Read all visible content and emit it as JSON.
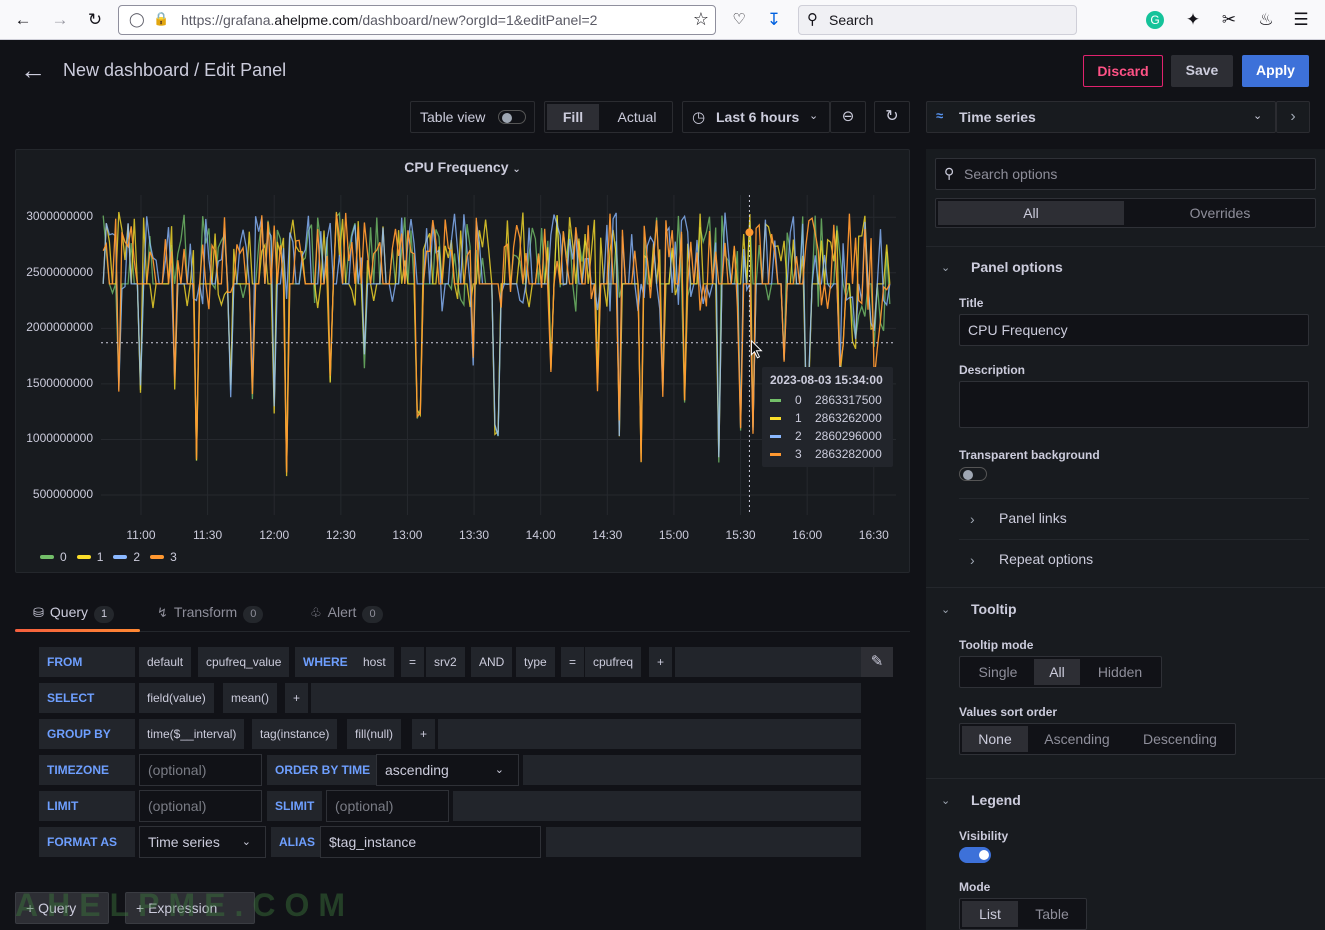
{
  "browser": {
    "url_prefix": "https://grafana.",
    "url_domain": "ahelpme.com",
    "url_suffix": "/dashboard/new?orgId=1&editPanel=2",
    "search_placeholder": "Search"
  },
  "header": {
    "title": "New dashboard / Edit Panel",
    "discard_label": "Discard",
    "save_label": "Save",
    "apply_label": "Apply"
  },
  "toolbar": {
    "table_view_label": "Table view",
    "fill_label": "Fill",
    "actual_label": "Actual",
    "time_range_label": "Last 6 hours"
  },
  "panel": {
    "title": "CPU Frequency",
    "tooltip": {
      "time": "2023-08-03 15:34:00",
      "rows": [
        {
          "name": "0",
          "value": "2863317500",
          "color": "#73bf69"
        },
        {
          "name": "1",
          "value": "2863262000",
          "color": "#fade2a"
        },
        {
          "name": "2",
          "value": "2860296000",
          "color": "#8ab8ff"
        },
        {
          "name": "3",
          "value": "2863282000",
          "color": "#ff9830"
        }
      ]
    }
  },
  "chart_data": {
    "type": "line",
    "title": "CPU Frequency",
    "xlabel": "",
    "ylabel": "",
    "x_ticks": [
      "11:00",
      "11:30",
      "12:00",
      "12:30",
      "13:00",
      "13:30",
      "14:00",
      "14:30",
      "15:00",
      "15:30",
      "16:00",
      "16:30"
    ],
    "y_ticks": [
      500000000,
      1000000000,
      1500000000,
      2000000000,
      2500000000,
      3000000000
    ],
    "y_tick_labels": [
      "500000000",
      "1000000000",
      "1500000000",
      "2000000000",
      "2500000000",
      "3000000000"
    ],
    "ylim": [
      320000000,
      3200000000
    ],
    "grid": true,
    "legend": "bottom-left",
    "series": [
      {
        "name": "0",
        "color": "#73bf69",
        "baseline": 2400000000
      },
      {
        "name": "1",
        "color": "#fade2a",
        "baseline": 2400000000
      },
      {
        "name": "2",
        "color": "#8ab8ff",
        "baseline": 2400000000
      },
      {
        "name": "3",
        "color": "#ff9830",
        "baseline": 2400000000
      }
    ],
    "dips": [
      {
        "t": "10:50",
        "v": 1500000000
      },
      {
        "t": "11:00",
        "v": 1450000000
      },
      {
        "t": "11:15",
        "v": 1500000000
      },
      {
        "t": "11:25",
        "v": 800000000
      },
      {
        "t": "11:40",
        "v": 1450000000
      },
      {
        "t": "11:50",
        "v": 1400000000
      },
      {
        "t": "12:00",
        "v": 1250000000
      },
      {
        "t": "12:05",
        "v": 650000000
      },
      {
        "t": "12:25",
        "v": 1500000000
      },
      {
        "t": "12:40",
        "v": 1700000000
      },
      {
        "t": "13:05",
        "v": 1200000000
      },
      {
        "t": "13:30",
        "v": 1700000000
      },
      {
        "t": "13:40",
        "v": 1100000000
      },
      {
        "t": "14:05",
        "v": 1600000000
      },
      {
        "t": "14:25",
        "v": 1500000000
      },
      {
        "t": "14:35",
        "v": 1100000000
      },
      {
        "t": "14:45",
        "v": 800000000
      },
      {
        "t": "14:55",
        "v": 1400000000
      },
      {
        "t": "15:05",
        "v": 1300000000
      },
      {
        "t": "15:20",
        "v": 850000000
      },
      {
        "t": "15:30",
        "v": 1050000000
      },
      {
        "t": "15:35",
        "v": 1100000000
      },
      {
        "t": "15:50",
        "v": 1700000000
      },
      {
        "t": "16:00",
        "v": 1550000000
      },
      {
        "t": "16:15",
        "v": 1650000000
      },
      {
        "t": "16:20",
        "v": 800000000
      },
      {
        "t": "16:30",
        "v": 1600000000
      }
    ]
  },
  "query_tabs": [
    {
      "label": "Query",
      "count": "1"
    },
    {
      "label": "Transform",
      "count": "0"
    },
    {
      "label": "Alert",
      "count": "0"
    }
  ],
  "query": {
    "from_kw": "FROM",
    "from_policy": "default",
    "from_measurement": "cpufreq_value",
    "where_kw": "WHERE",
    "where_1_key": "host",
    "where_1_op": "=",
    "where_1_val": "srv2",
    "where_and": "AND",
    "where_2_key": "type",
    "where_2_op": "=",
    "where_2_val": "cpufreq",
    "select_kw": "SELECT",
    "select_field": "field(value)",
    "select_fn": "mean()",
    "groupby_kw": "GROUP BY",
    "groupby_time": "time($__interval)",
    "groupby_tag": "tag(instance)",
    "groupby_fill": "fill(null)",
    "timezone_kw": "TIMEZONE",
    "timezone_ph": "(optional)",
    "orderby_kw": "ORDER BY TIME",
    "orderby_val": "ascending",
    "limit_kw": "LIMIT",
    "limit_ph": "(optional)",
    "slimit_kw": "SLIMIT",
    "slimit_ph": "(optional)",
    "format_kw": "FORMAT AS",
    "format_val": "Time series",
    "alias_kw": "ALIAS",
    "alias_val": "$tag_instance",
    "plus": "+",
    "add_query_label": "Query",
    "add_expression_label": "Expression"
  },
  "watermark": "AHELPME.COM",
  "options": {
    "viz_type": "Time series",
    "search_placeholder": "Search options",
    "tab_all": "All",
    "tab_overrides": "Overrides",
    "panel_options_heading": "Panel options",
    "title_label": "Title",
    "title_value": "CPU Frequency",
    "description_label": "Description",
    "transparent_label": "Transparent background",
    "panel_links": "Panel links",
    "repeat_options": "Repeat options",
    "tooltip_heading": "Tooltip",
    "tooltip_mode_label": "Tooltip mode",
    "tooltip_modes": [
      "Single",
      "All",
      "Hidden"
    ],
    "sort_label": "Values sort order",
    "sort_orders": [
      "None",
      "Ascending",
      "Descending"
    ],
    "legend_heading": "Legend",
    "visibility_label": "Visibility",
    "mode_label": "Mode",
    "modes": [
      "List",
      "Table"
    ]
  }
}
